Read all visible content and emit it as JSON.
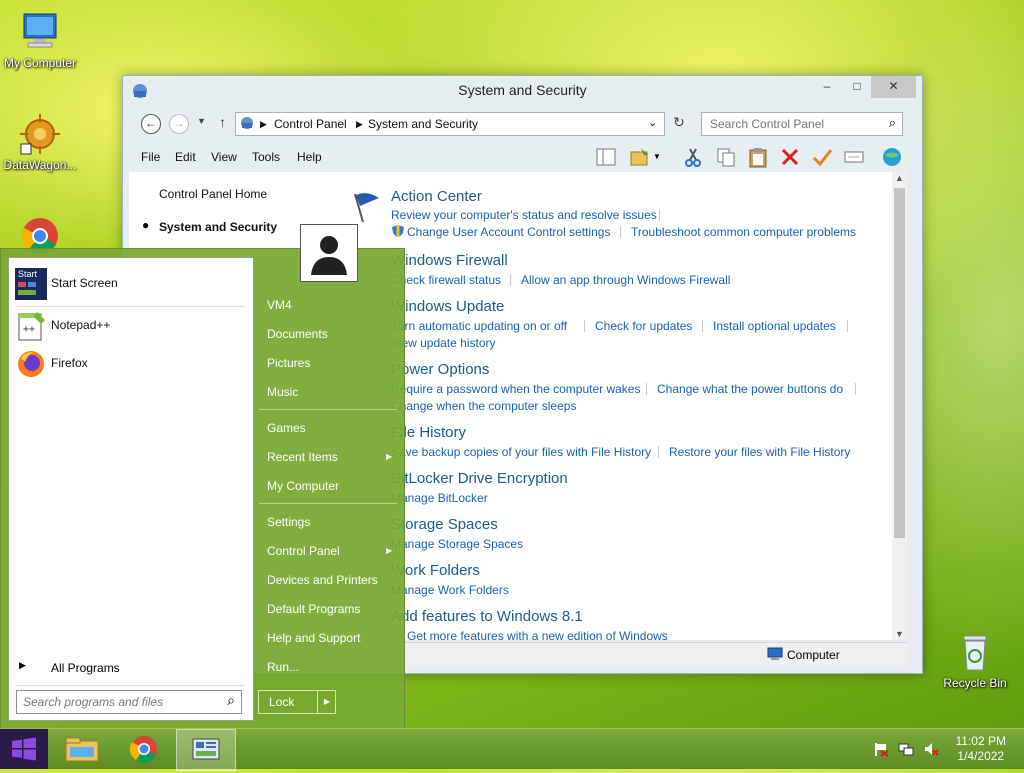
{
  "desktop": {
    "icons": [
      {
        "label": "My Computer"
      },
      {
        "label": "DataWagon..."
      },
      {
        "label": "Recycle Bin"
      }
    ]
  },
  "window": {
    "title": "System and Security",
    "controls": {
      "minimize": "–",
      "maximize": "□",
      "close": "✕"
    },
    "address": {
      "crumb1": "Control Panel",
      "crumb2": "System and Security"
    },
    "search_placeholder": "Search Control Panel",
    "menu": [
      "File",
      "Edit",
      "View",
      "Tools",
      "Help"
    ],
    "left_nav": {
      "home": "Control Panel Home",
      "current": "System and Security"
    },
    "sections": [
      {
        "title": "Action Center",
        "links": [
          "Review your computer's status and resolve issues",
          "Change User Account Control settings",
          "Troubleshoot common computer problems"
        ]
      },
      {
        "title": "Windows Firewall",
        "links": [
          "Check firewall status",
          "Allow an app through Windows Firewall"
        ]
      },
      {
        "title": "Windows Update",
        "links": [
          "Turn automatic updating on or off",
          "Check for updates",
          "Install optional updates",
          "View update history"
        ]
      },
      {
        "title": "Power Options",
        "links": [
          "Require a password when the computer wakes",
          "Change what the power buttons do",
          "Change when the computer sleeps"
        ]
      },
      {
        "title": "File History",
        "links": [
          "Save backup copies of your files with File History",
          "Restore your files with File History"
        ]
      },
      {
        "title": "BitLocker Drive Encryption",
        "links": [
          "Manage BitLocker"
        ]
      },
      {
        "title": "Storage Spaces",
        "links": [
          "Manage Storage Spaces"
        ]
      },
      {
        "title": "Work Folders",
        "links": [
          "Manage Work Folders"
        ]
      },
      {
        "title": "Add features to Windows 8.1",
        "links": [
          "Get more features with a new edition of Windows"
        ]
      }
    ],
    "status": "Computer"
  },
  "start_menu": {
    "left_items": [
      "Start Screen",
      "Notepad++",
      "Firefox"
    ],
    "start_icon_text": "Start",
    "all_programs": "All Programs",
    "search_placeholder": "Search programs and files",
    "right_items": [
      "VM4",
      "Documents",
      "Pictures",
      "Music",
      "Games",
      "Recent Items",
      "My Computer",
      "Settings",
      "Control Panel",
      "Devices and Printers",
      "Default Programs",
      "Help and Support",
      "Run..."
    ],
    "lock": "Lock"
  },
  "taskbar": {
    "time": "11:02 PM",
    "date": "1/4/2022"
  }
}
